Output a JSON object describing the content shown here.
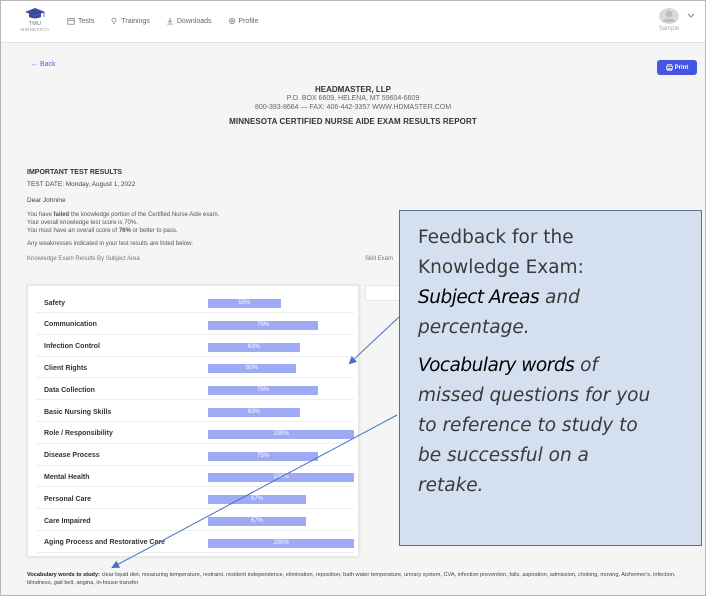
{
  "nav": {
    "logo_line1": "TMU",
    "logo_line2": "MINNESOTA",
    "links": [
      {
        "label": "Tests",
        "icon": "calendar-icon"
      },
      {
        "label": "Trainings",
        "icon": "lightbulb-icon"
      },
      {
        "label": "Downloads",
        "icon": "download-icon"
      },
      {
        "label": "Profile",
        "icon": "gear-icon"
      }
    ],
    "user_name": "Sample"
  },
  "toolbar": {
    "back_label": "Back",
    "print_label": "Print"
  },
  "header": {
    "company": "HEADMASTER, LLP",
    "address": "P.O. BOX 6609, HELENA, MT 59604-6609",
    "phone": "800-393-8664 — FAX: 406-442-3357 WWW.HDMASTER.COM",
    "report_title": "MINNESOTA CERTIFIED NURSE AIDE EXAM RESULTS REPORT"
  },
  "results": {
    "important_heading": "IMPORTANT TEST RESULTS",
    "test_date": "TEST DATE: Monday, August 1, 2022",
    "greeting": "Dear Johnine",
    "failed_pre": "You have ",
    "failed_word": "failed",
    "failed_post": " the knowledge portion of the Certified Nurse Aide exam.",
    "score_line": "Your overall knowledge test score is 70%.",
    "pass_pre": "You must have an overall score of ",
    "pass_score": "76%",
    "pass_post": " or better to pass.",
    "weakness_note": "Any weaknesses indicated in your test results are listed below:",
    "knowledge_label": "Knowledge Exam Results By Subject Area",
    "skill_label": "Skill Exam"
  },
  "subjects": [
    {
      "name": "Safety",
      "percent": "50%",
      "value": 50
    },
    {
      "name": "Communication",
      "percent": "75%",
      "value": 75
    },
    {
      "name": "Infection Control",
      "percent": "63%",
      "value": 63
    },
    {
      "name": "Client Rights",
      "percent": "60%",
      "value": 60
    },
    {
      "name": "Data Collection",
      "percent": "75%",
      "value": 75
    },
    {
      "name": "Basic Nursing Skills",
      "percent": "63%",
      "value": 63
    },
    {
      "name": "Role / Responsibility",
      "percent": "100%",
      "value": 100
    },
    {
      "name": "Disease Process",
      "percent": "75%",
      "value": 75
    },
    {
      "name": "Mental Health",
      "percent": "100%",
      "value": 100
    },
    {
      "name": "Personal Care",
      "percent": "67%",
      "value": 67
    },
    {
      "name": "Care Impaired",
      "percent": "67%",
      "value": 67
    },
    {
      "name": "Aging Process and Restorative Care",
      "percent": "100%",
      "value": 100
    }
  ],
  "vocab": {
    "label": "Vocabulary words to study:",
    "words": "clear liquid diet, measuring temperature, restraint, resident independence, elimination, reposition, bath water temperature, urinary system, CVA, infection prevention, falls, aspiration, admission, choking, moving, Alzheimer's, infection, blindness, gait belt, angina, in-house transfer"
  },
  "callout": {
    "line1": "Feedback for the",
    "line2": "Knowledge Exam:",
    "line3_hl": "Subject Areas",
    "line3_rest": " and",
    "line4": "percentage.",
    "line5_hl": "Vocabulary words",
    "line5_rest": " of",
    "line6": "missed questions for you",
    "line7": "to reference to study to",
    "line8": "be successful on a",
    "line9": "retake."
  },
  "colors": {
    "accent": "#4457e0",
    "bar": "#9eaaf4",
    "callout_bg": "#d4dff0",
    "arrow": "#4472c4"
  }
}
